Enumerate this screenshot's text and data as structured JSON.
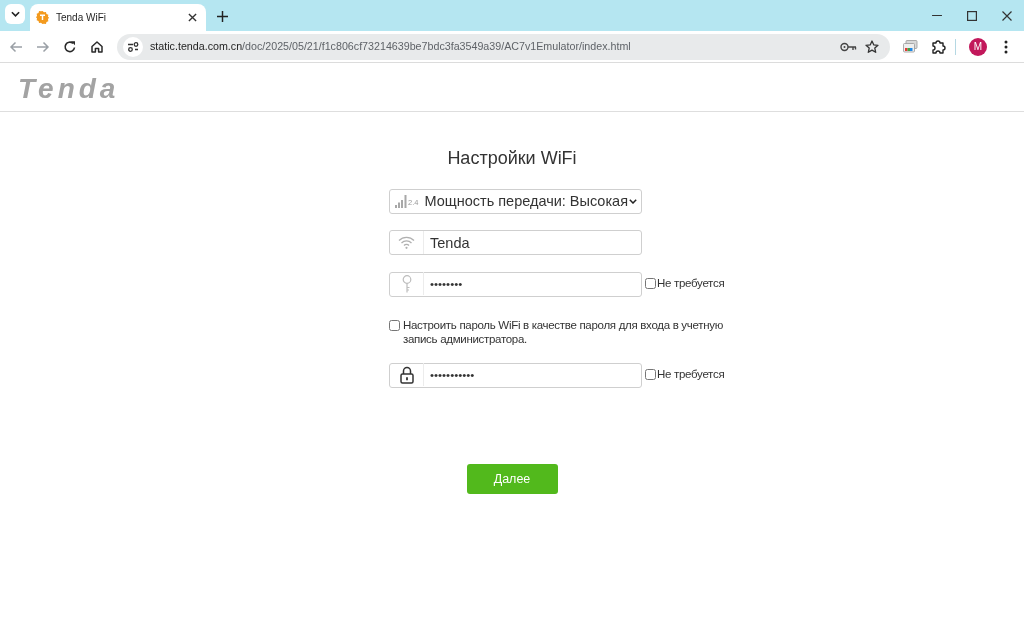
{
  "browser": {
    "tabs": [
      {
        "title": "Tenda WiFi",
        "selected": true
      }
    ],
    "nav_buttons": [
      {
        "kind": "back",
        "disabled": true
      },
      {
        "kind": "forward",
        "disabled": true
      },
      {
        "kind": "reload",
        "disabled": false
      },
      {
        "kind": "home",
        "disabled": false
      }
    ],
    "address": {
      "host": "static.tenda.com.cn",
      "path": "/doc/2025/05/21/f1c806cf73214639be7bdc3fa3549a39/AC7v1Emulator/index.html"
    },
    "profile_initial": "M"
  },
  "header": {
    "logo": "Tenda"
  },
  "form": {
    "title": "Настройки WiFi",
    "fields": [
      {
        "kind": "power_select",
        "band": "2.4",
        "value": "Мощность передачи: Высокая"
      },
      {
        "kind": "ssid",
        "value": "Tenda"
      },
      {
        "kind": "wifi_password",
        "value": "••••••••",
        "not_required": {
          "label": "Не требуется",
          "checked": false
        }
      },
      {
        "kind": "admin_option",
        "label": "Настроить пароль WiFi в качестве пароля для входа в учетную запись администратора.",
        "checked": false
      },
      {
        "kind": "admin_password",
        "value": "•••••••••••",
        "not_required": {
          "label": "Не требуется",
          "checked": false
        }
      }
    ],
    "submit": "Далее"
  }
}
